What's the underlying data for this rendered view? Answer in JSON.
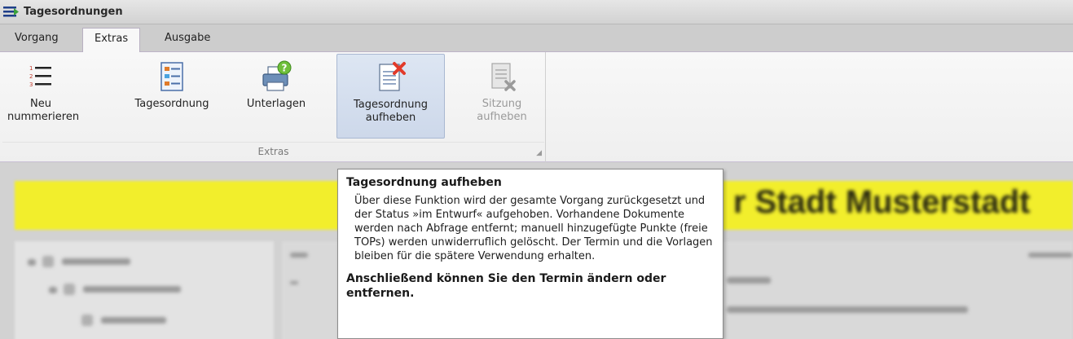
{
  "window": {
    "title": "Tagesordnungen",
    "icon": "list-icon"
  },
  "tabs": [
    {
      "label": "Vorgang",
      "active": false
    },
    {
      "label": "Extras",
      "active": true
    },
    {
      "label": "Ausgabe",
      "active": false
    }
  ],
  "ribbon": {
    "group_label": "Extras",
    "buttons": [
      {
        "label": "Neu\nnummerieren",
        "icon": "numbered-list-icon",
        "state": "normal"
      },
      {
        "label": "Tagesordnung",
        "icon": "agenda-icon",
        "state": "normal"
      },
      {
        "label": "Unterlagen",
        "icon": "printer-help-icon",
        "state": "normal"
      },
      {
        "label": "Tagesordnung\naufheben",
        "icon": "document-delete-icon",
        "state": "hover"
      },
      {
        "label": "Sitzung\naufheben",
        "icon": "session-delete-icon",
        "state": "disabled"
      }
    ]
  },
  "background": {
    "banner_text": "r Stadt Musterstadt"
  },
  "tooltip": {
    "title": "Tagesordnung aufheben",
    "body": "Über diese Funktion wird der gesamte Vorgang zurückgesetzt und der Status »im Entwurf« aufgehoben. Vorhandene Dokumente werden nach Abfrage entfernt; manuell hinzugefügte Punkte (freie TOPs) werden unwiderruflich gelöscht. Der Termin und die Vorlagen bleiben für die spätere Verwendung erhalten.",
    "footer": "Anschließend können Sie den Termin ändern oder entfernen."
  },
  "colors": {
    "banner_yellow": "#f2ee2c",
    "hover_blue": "#cdd8ea",
    "delete_red": "#e23a2a",
    "help_green": "#6fbf3a"
  }
}
